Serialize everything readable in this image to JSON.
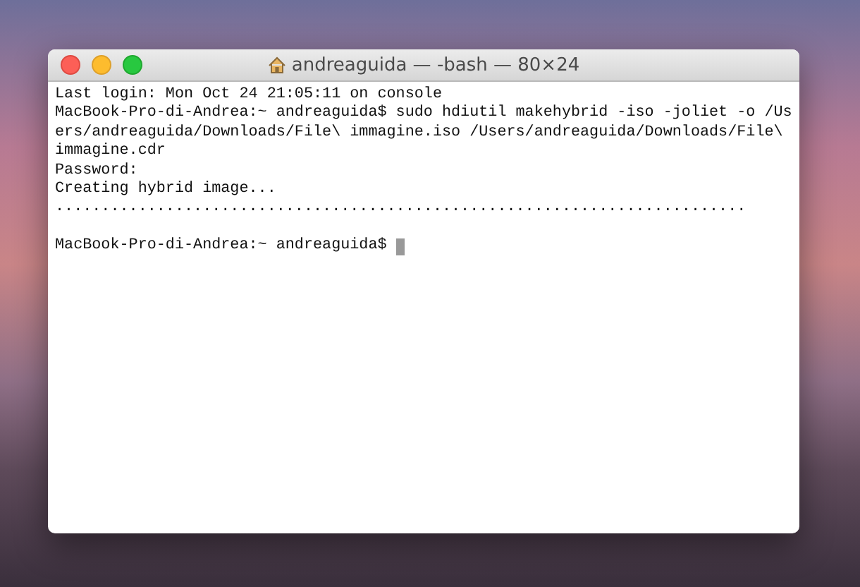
{
  "window": {
    "title": "andreaguida — -bash — 80×24"
  },
  "terminal": {
    "lines": [
      "Last login: Mon Oct 24 21:05:11 on console",
      "MacBook-Pro-di-Andrea:~ andreaguida$ sudo hdiutil makehybrid -iso -joliet -o /Us",
      "ers/andreaguida/Downloads/File\\ immagine.iso /Users/andreaguida/Downloads/File\\",
      "immagine.cdr",
      "Password:",
      "Creating hybrid image...",
      "..........................................................................."
    ],
    "prompt": {
      "text": "MacBook-Pro-di-Andrea:~ andreaguida$",
      "cursor": true
    }
  }
}
